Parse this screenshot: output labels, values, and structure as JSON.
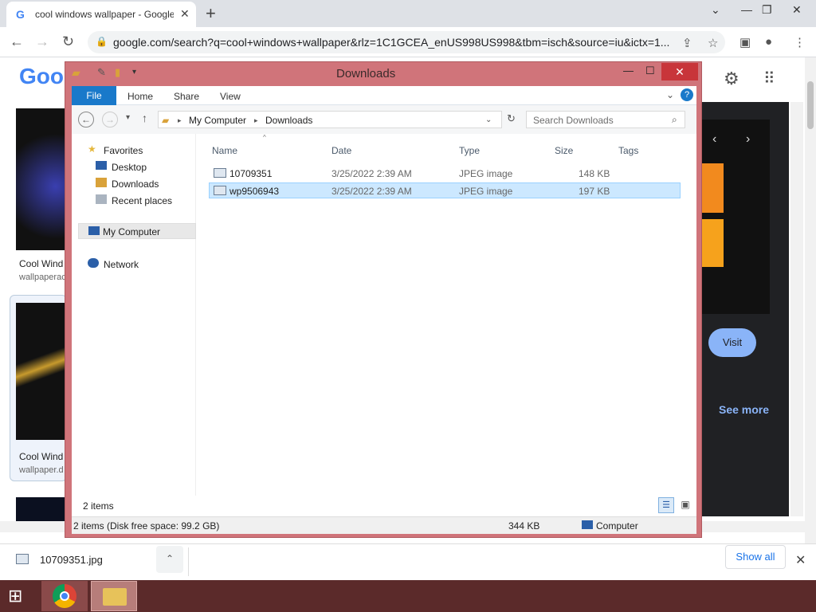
{
  "browser": {
    "tab_title": "cool windows wallpaper - Google",
    "url": "google.com/search?q=cool+windows+wallpaper&rlz=1C1GCEA_enUS998US998&tbm=isch&source=iu&ictx=1...",
    "favicon_letter": "G"
  },
  "google": {
    "logo_text": "Goo",
    "result1_caption": "Cool Wind",
    "result1_source": "wallpaperac",
    "result2_caption": "Cool Wind",
    "result2_source": "wallpaper.d",
    "visit_label": "Visit",
    "see_more_label": "See more"
  },
  "explorer": {
    "title": "Downloads",
    "ribbon_tabs": [
      "File",
      "Home",
      "Share",
      "View"
    ],
    "address_path": [
      "My Computer",
      "Downloads"
    ],
    "search_placeholder": "Search Downloads",
    "nav": {
      "favorites": "Favorites",
      "desktop": "Desktop",
      "downloads": "Downloads",
      "recent": "Recent places",
      "computer": "My Computer",
      "network": "Network"
    },
    "columns": [
      "Name",
      "Date",
      "Type",
      "Size",
      "Tags"
    ],
    "files": [
      {
        "name": "10709351",
        "date": "3/25/2022 2:39 AM",
        "type": "JPEG image",
        "size": "148 KB"
      },
      {
        "name": "wp9506943",
        "date": "3/25/2022 2:39 AM",
        "type": "JPEG image",
        "size": "197 KB"
      }
    ],
    "item_count": "2 items",
    "status_left": "2 items (Disk free space: 99.2 GB)",
    "status_size": "344 KB",
    "status_location": "Computer"
  },
  "downloads_bar": {
    "file_name": "10709351.jpg",
    "show_all_label": "Show all"
  },
  "colors": {
    "explorer_frame": "#d0747a",
    "file_tab": "#1979ca",
    "selection": "#cce8ff"
  }
}
